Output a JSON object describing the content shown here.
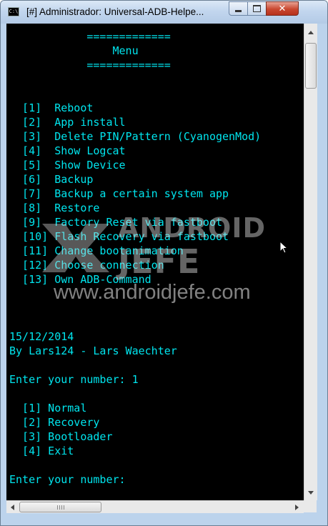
{
  "window": {
    "title": "[#] Administrador:  Universal-ADB-Helpe...",
    "icon_label": "C:\\",
    "controls": [
      "minimize-icon",
      "maximize-icon",
      "close-icon"
    ],
    "close_glyph": "✕"
  },
  "console": {
    "text_color": "#00e5ee",
    "background": "#000000",
    "lines": [
      "            =============",
      "                Menu",
      "            =============",
      "",
      "",
      "  [1]  Reboot",
      "  [2]  App install",
      "  [3]  Delete PIN/Pattern (CyanogenMod)",
      "  [4]  Show Logcat",
      "  [5]  Show Device",
      "  [6]  Backup",
      "  [7]  Backup a certain system app",
      "  [8]  Restore",
      "  [9]  Factory Reset via fastboot",
      "  [10] Flash Recovery via fastboot",
      "  [11] Change bootanimation",
      "  [12] Choose connection",
      "  [13] Own ADB-Command",
      "",
      "",
      "",
      "15/12/2014",
      "By Lars124 - Lars Waechter",
      "",
      "Enter your number: 1",
      "",
      "  [1] Normal",
      "  [2] Recovery",
      "  [3] Bootloader",
      "  [4] Exit",
      "",
      "Enter your number:"
    ]
  },
  "watermark": {
    "line1": "ANDROID",
    "line2": "JEFE",
    "line3": "www.androidjefe.com"
  }
}
